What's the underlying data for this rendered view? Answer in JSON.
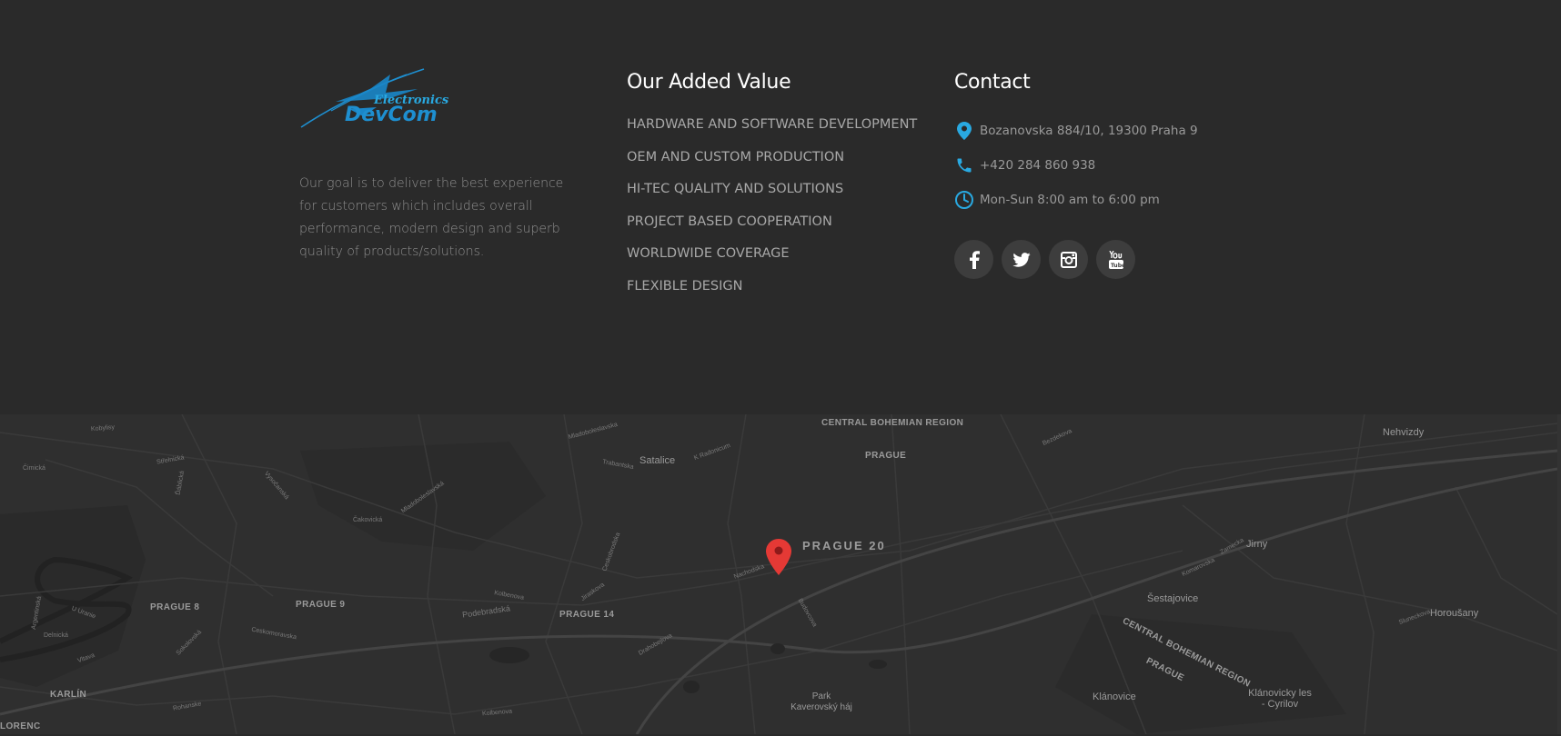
{
  "about": {
    "logo_text_top": "Electronics",
    "logo_text_main": "DevCom",
    "description": "Our goal is to deliver the best experience for customers which includes overall performance, modern design and superb quality of products/solutions."
  },
  "values": {
    "title": "Our Added Value",
    "items": [
      "HARDWARE AND SOFTWARE DEVELOPMENT",
      "OEM AND CUSTOM PRODUCTION",
      "HI-TEC QUALITY AND SOLUTIONS",
      "PROJECT BASED COOPERATION",
      "WORLDWIDE COVERAGE",
      "FLEXIBLE DESIGN"
    ]
  },
  "contact": {
    "title": "Contact",
    "address": "Bozanovska 884/10, 19300 Praha 9",
    "phone": "+420 284 860 938",
    "hours": "Mon-Sun 8:00 am to 6:00 pm",
    "accent_color": "#29a9e1",
    "socials": [
      "facebook-icon",
      "twitter-icon",
      "instagram-icon",
      "youtube-icon"
    ]
  },
  "map": {
    "districts": [
      "PRAGUE 20",
      "PRAGUE 8",
      "PRAGUE 9",
      "PRAGUE 14",
      "KARLÍN",
      "LORENC"
    ],
    "region_labels": [
      "CENTRAL BOHEMIAN REGION",
      "PRAGUE",
      "CENTRAL BOHEMIAN REGION",
      "PRAGUE"
    ],
    "towns": [
      "Satalice",
      "Nehvizdy",
      "Jirny",
      "Šestajovice",
      "Horoušany",
      "Klánovice",
      "Klánovicky les - Cyrilov",
      "Park Kaverovský háj"
    ],
    "streets": [
      "Čimická",
      "Střelnická",
      "Ďáblická",
      "Kobylisy",
      "Vysočanská",
      "Čakovická",
      "Mladoboleslavská",
      "Podebradská",
      "Kolbenova",
      "Jiraskova",
      "Ceskomoravska",
      "Sokolovská",
      "Vltava",
      "Argentinská",
      "Delnická",
      "U Uranie",
      "Nachodska",
      "Budovcova",
      "Drahobejlova",
      "Trabantska",
      "K Radonicum",
      "Mladoboleslavska",
      "Bezdekova",
      "Kolbenova",
      "Rohanske",
      "Ceskobrodska",
      "Komarovska",
      "Zamecka",
      "Sluneckova"
    ],
    "marker_color": "#e53935"
  }
}
